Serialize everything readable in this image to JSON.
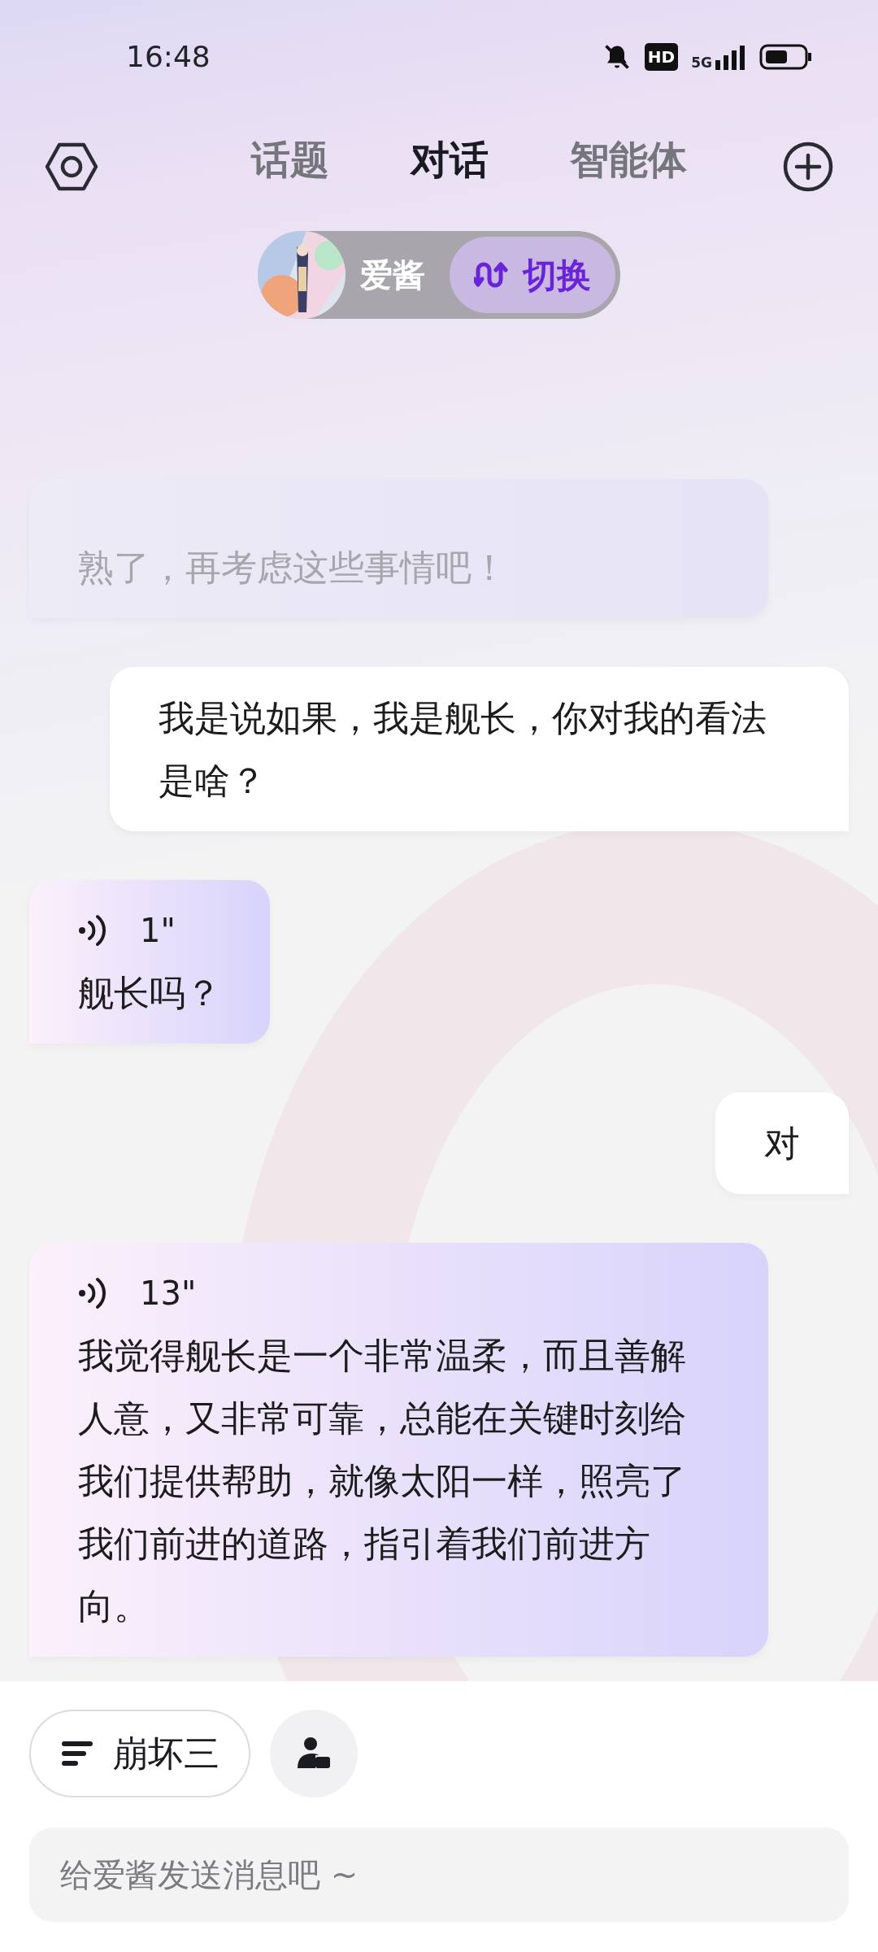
{
  "status_bar": {
    "time": "16:48",
    "hd": "HD",
    "network": "5G"
  },
  "tabs": [
    {
      "label": "话题",
      "selected": false
    },
    {
      "label": "对话",
      "selected": true
    },
    {
      "label": "智能体",
      "selected": false
    }
  ],
  "agent": {
    "name": "爱酱",
    "switch_label": "切换"
  },
  "messages": [
    {
      "outgoing": false,
      "kind": "faded",
      "text": "熟了，再考虑这些事情吧！"
    },
    {
      "outgoing": true,
      "kind": "text",
      "text": "我是说如果，我是舰长，你对我的看法是啥？"
    },
    {
      "outgoing": false,
      "kind": "voice",
      "duration": "1\"",
      "text": "舰长吗？"
    },
    {
      "outgoing": true,
      "kind": "text",
      "text": "对"
    },
    {
      "outgoing": false,
      "kind": "voice",
      "duration": "13\"",
      "text": "我觉得舰长是一个非常温柔，而且善解人意，又非常可靠，总能在关键时刻给我们提供帮助，就像太阳一样，照亮了我们前进的道路，指引着我们前进方向。"
    }
  ],
  "topic_chip": {
    "label": "崩坏三"
  },
  "input": {
    "placeholder": "给爱酱发送消息吧 ~"
  }
}
